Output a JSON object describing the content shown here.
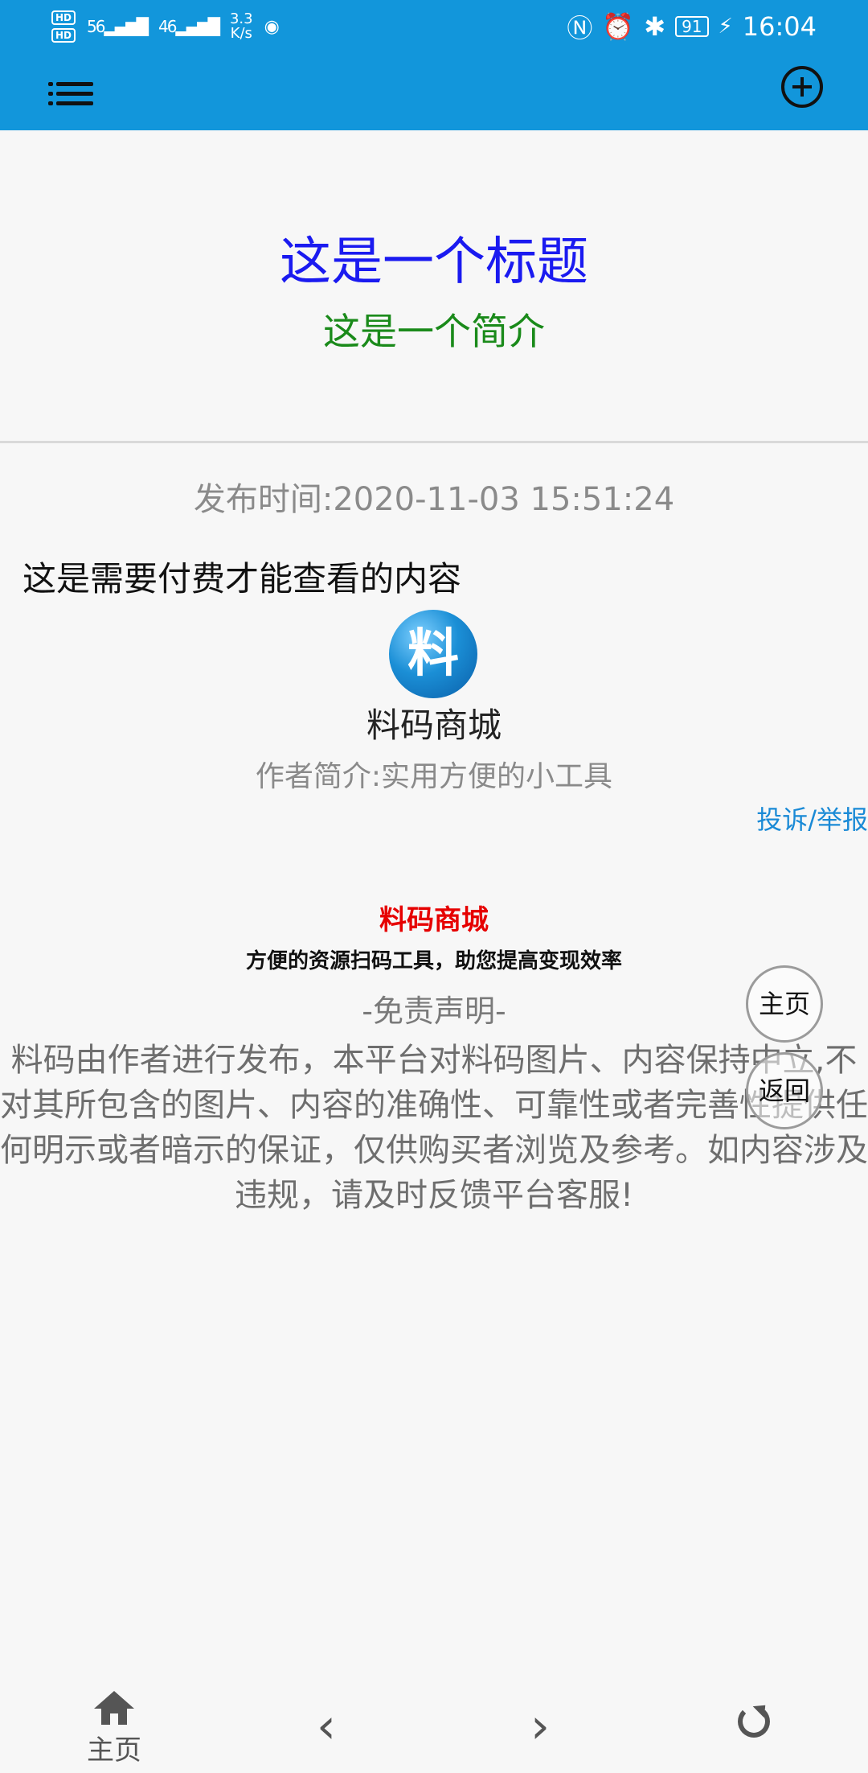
{
  "status_bar": {
    "hd_1": "HD",
    "hd_2": "HD",
    "sig_1": "56",
    "sig_2": "46",
    "speed_value": "3.3",
    "speed_unit": "K/s",
    "battery": "91",
    "time": "16:04"
  },
  "appbar": {
    "menu_icon": "menu-icon",
    "add_icon": "plus-circle-icon"
  },
  "article": {
    "title": "这是一个标题",
    "subtitle": "这是一个简介",
    "published": "发布时间:2020-11-03 15:51:24",
    "paid_notice": "这是需要付费才能查看的内容"
  },
  "author": {
    "logo_char": "料",
    "name": "料码商城",
    "bio": "作者简介:实用方便的小工具",
    "report": "投诉/举报"
  },
  "shop": {
    "title": "料码商城",
    "description": "方便的资源扫码工具，助您提高变现效率",
    "disclaimer_heading": "-免责声明-",
    "disclaimer_text": "料码由作者进行发布，本平台对料码图片、内容保持中立,不对其所包含的图片、内容的准确性、可靠性或者完善性提供任何明示或者暗示的保证，仅供购买者浏览及参考。如内容涉及违规，请及时反馈平台客服!"
  },
  "floating": {
    "home": "主页",
    "back": "返回"
  },
  "bottom_nav": {
    "home_label": "主页",
    "back_arrow": "‹",
    "forward_arrow": "›"
  },
  "colors": {
    "topbar": "#1296db",
    "title": "#1a1af0",
    "subtitle": "#1a8a1a",
    "shop_title": "#e60000",
    "report_link": "#1a8ad6"
  }
}
